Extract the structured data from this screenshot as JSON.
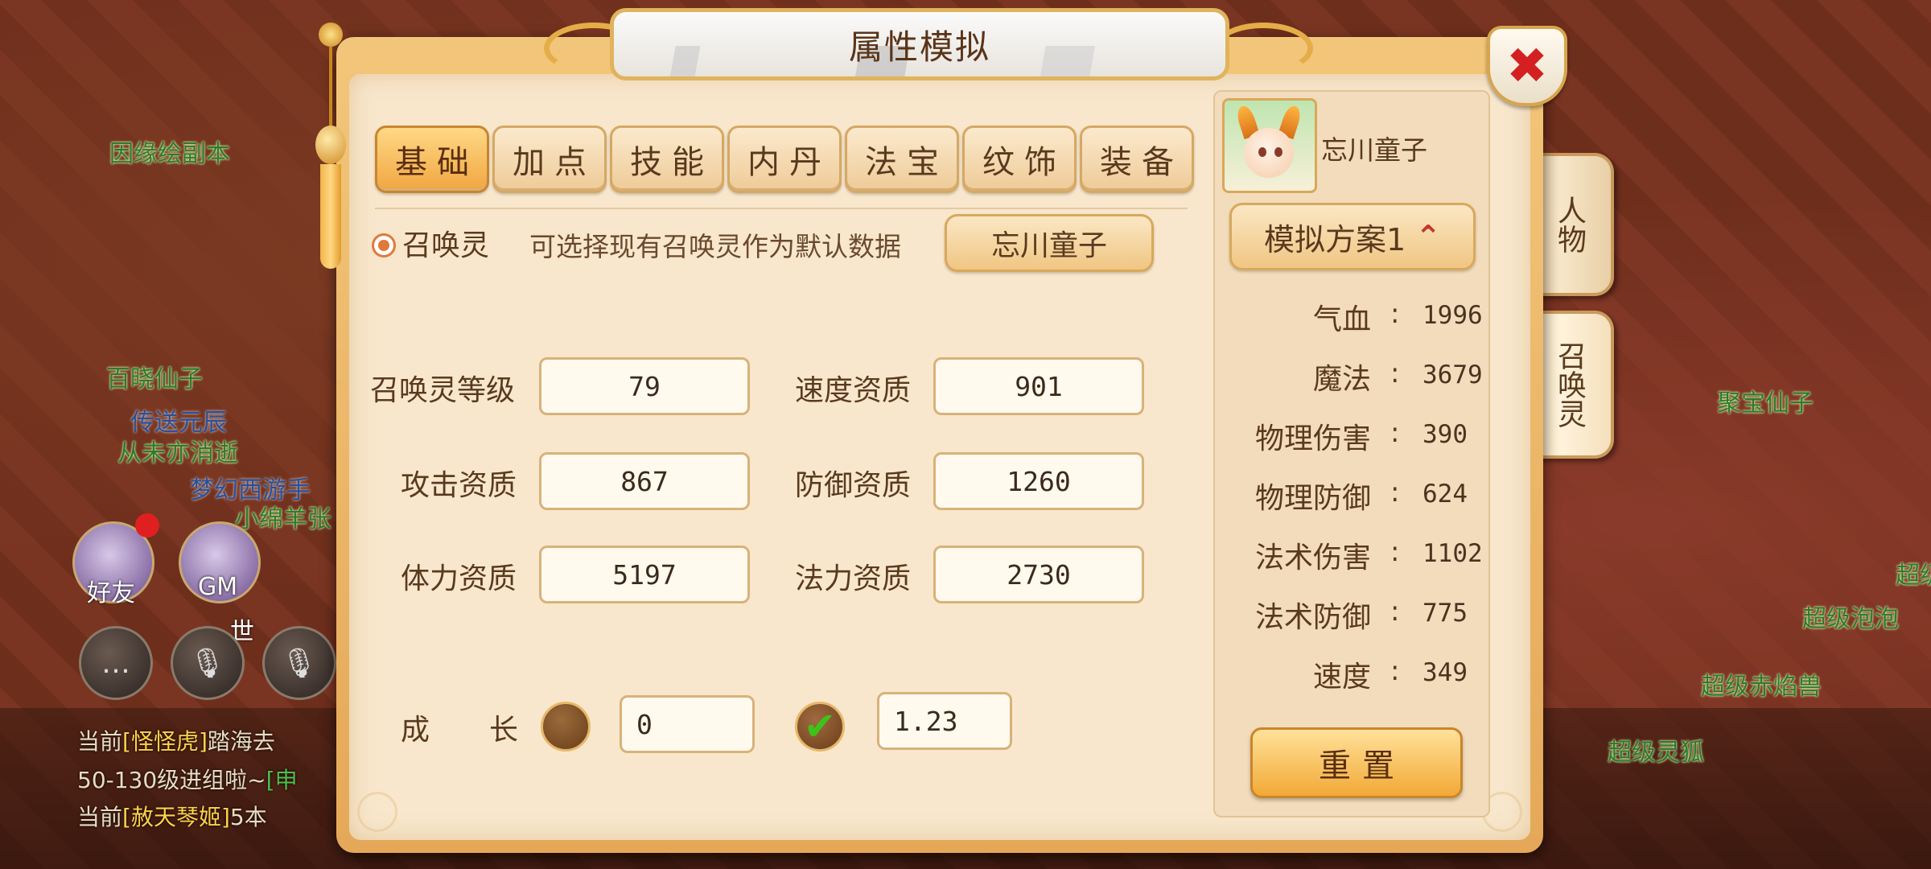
{
  "background": {
    "npc_labels": [
      "因缘绘副本",
      "百晓仙子",
      "传送元辰",
      "从未亦消逝",
      "梦幻西游手",
      "小绵羊张",
      "聚宝仙子",
      "超级泡泡",
      "超级赤焰兽",
      "超级灵狐",
      "超级"
    ],
    "friends_label": "好友",
    "gm_label": "GM",
    "world_label": "世",
    "chat": [
      {
        "prefix": "当前",
        "bracket": "[怪怪虎]",
        "text": "踏海去"
      },
      {
        "prefix": "50-130级进组啦~",
        "bracket": "[申",
        "text": ""
      },
      {
        "prefix": "当前",
        "bracket": "[赦天琴姬]",
        "text": "5本"
      }
    ]
  },
  "side_tabs": [
    "人物",
    "召唤灵"
  ],
  "dialog": {
    "title": "属性模拟",
    "close_label": "✖",
    "tabs": [
      {
        "label": "基础",
        "active": true
      },
      {
        "label": "加点",
        "active": false
      },
      {
        "label": "技能",
        "active": false
      },
      {
        "label": "内丹",
        "active": false
      },
      {
        "label": "法宝",
        "active": false
      },
      {
        "label": "纹饰",
        "active": false
      },
      {
        "label": "装备",
        "active": false
      }
    ],
    "summon": {
      "radio_label": "召唤灵",
      "hint": "可选择现有召唤灵作为默认数据",
      "select_button": "忘川童子"
    },
    "fields": {
      "level_label": "召唤灵等级",
      "level_value": "79",
      "speed_apt_label": "速度资质",
      "speed_apt_value": "901",
      "attack_apt_label": "攻击资质",
      "attack_apt_value": "867",
      "defense_apt_label": "防御资质",
      "defense_apt_value": "1260",
      "hp_apt_label": "体力资质",
      "hp_apt_value": "5197",
      "mp_apt_label": "法力资质",
      "mp_apt_value": "2730"
    },
    "growth": {
      "label_a": "成",
      "label_b": "长",
      "value_unchecked": "0",
      "value_checked": "1.23",
      "check_mark": "✔"
    },
    "right_panel": {
      "pet_name": "忘川童子",
      "plan_button": "模拟方案1",
      "plan_icon": "⌃",
      "colon": ":",
      "stats": [
        {
          "label": "气血",
          "value": "1996"
        },
        {
          "label": "魔法",
          "value": "3679"
        },
        {
          "label": "物理伤害",
          "value": "390"
        },
        {
          "label": "物理防御",
          "value": "624"
        },
        {
          "label": "法术伤害",
          "value": "1102"
        },
        {
          "label": "法术防御",
          "value": "775"
        },
        {
          "label": "速度",
          "value": "349"
        }
      ],
      "reset_button": "重置"
    }
  },
  "colors": {
    "frame": "#e5a859",
    "panel": "#f8e7cc",
    "active_tab": "#f0a640",
    "close_x": "#d42020",
    "check": "#3ec21a"
  }
}
